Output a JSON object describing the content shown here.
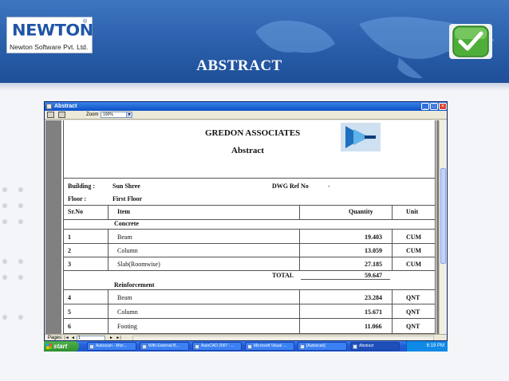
{
  "slide": {
    "title": "ABSTRACT",
    "logo_mark": "NEWTON",
    "logo_reg": "®",
    "logo_subtitle": "Newton Software Pvt. Ltd."
  },
  "window": {
    "title": "Abstract",
    "min_glyph": "_",
    "max_glyph": "□",
    "close_glyph": "×",
    "zoom_label": "Zoom",
    "zoom_value": "100%",
    "pages_label": "Pages:",
    "page_value": "1",
    "nav_first": "|◄",
    "nav_prev": "◄",
    "nav_next": "►",
    "nav_last": "►|"
  },
  "report": {
    "company": "GREDON ASSOCIATES",
    "heading": "Abstract",
    "building_label": "Building :",
    "building_value": "Sun Shree",
    "dwg_label": "DWG Ref No",
    "dwg_value": "-",
    "floor_label": "Floor   :",
    "floor_value": "First Floor",
    "columns": {
      "srno": "Sr.No",
      "item": "Item",
      "quantity": "Quantity",
      "unit": "Unit"
    },
    "group1": "Concrete",
    "group2": "Reinforcement",
    "total_label": "TOTAL",
    "total_value": "59.647",
    "rows": [
      {
        "srno": "1",
        "item": "Beam",
        "quantity": "19.403",
        "unit": "CUM"
      },
      {
        "srno": "2",
        "item": "Column",
        "quantity": "13.059",
        "unit": "CUM"
      },
      {
        "srno": "3",
        "item": "Slab(Roomwise)",
        "quantity": "27.185",
        "unit": "CUM"
      },
      {
        "srno": "4",
        "item": "Beam",
        "quantity": "23.284",
        "unit": "QNT"
      },
      {
        "srno": "5",
        "item": "Column",
        "quantity": "15.671",
        "unit": "QNT"
      },
      {
        "srno": "6",
        "item": "Footing",
        "quantity": "11.066",
        "unit": "QNT"
      }
    ]
  },
  "taskbar": {
    "start": "start",
    "tasks": [
      "Autoscan - Micr...",
      "With External B...",
      "AutoCAD 2007 - ...",
      "Microsoft Visual ...",
      "[Autoscan]",
      "Abstract"
    ],
    "tray_time": "6:19 PM"
  }
}
